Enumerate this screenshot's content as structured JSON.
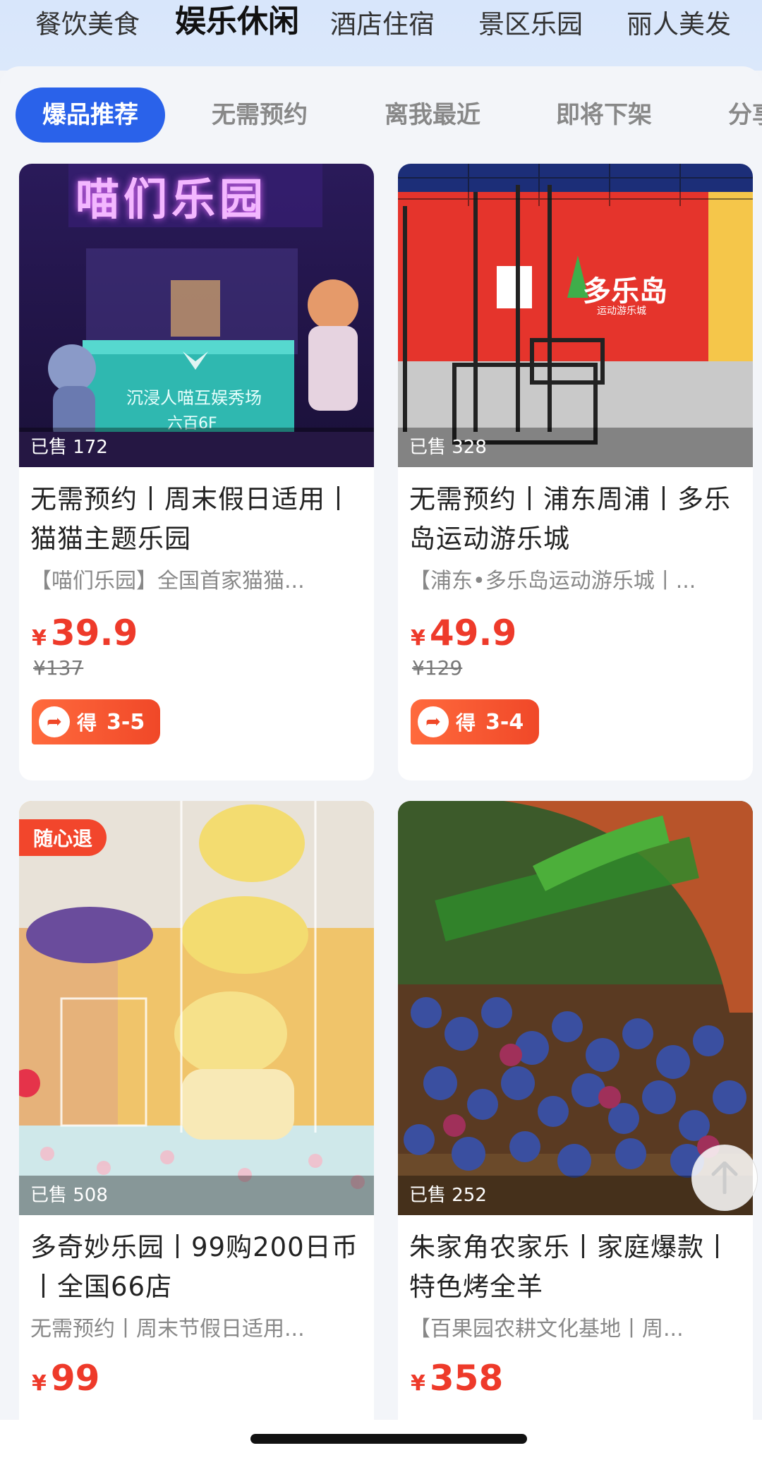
{
  "categories": [
    "餐饮美食",
    "娱乐休闲",
    "酒店住宿",
    "景区乐园",
    "丽人美发"
  ],
  "filters": [
    "爆品推荐",
    "无需预约",
    "离我最近",
    "即将下架",
    "分享"
  ],
  "items": [
    {
      "sold": "已售 172",
      "title": "无需预约丨周末假日适用丨猫猫主题乐园",
      "subtitle": "【喵们乐园】全国首家猫猫...",
      "price": "39.9",
      "orig_price": "¥137",
      "earn_label": "得",
      "earn_value": "3-5",
      "image_text_top": "喵们乐园",
      "image_text_banner": "沉浸人喵互娱秀场",
      "image_text_small": "六百6F"
    },
    {
      "sold": "已售 328",
      "title": "无需预约丨浦东周浦丨多乐岛运动游乐城",
      "subtitle": "【浦东•多乐岛运动游乐城丨...",
      "price": "49.9",
      "orig_price": "¥129",
      "earn_label": "得",
      "earn_value": "3-4",
      "image_text_sign": "多乐岛",
      "image_text_sign_sub": "运动游乐城"
    },
    {
      "sold": "已售 508",
      "tag": "随心退",
      "title": "多奇妙乐园丨99购200日币丨全国66店",
      "subtitle": "无需预约丨周末节假日适用...",
      "price": "99"
    },
    {
      "sold": "已售 252",
      "title": "朱家角农家乐丨家庭爆款丨特色烤全羊",
      "subtitle": "【百果园农耕文化基地丨周...",
      "price": "358"
    }
  ],
  "currency": "¥",
  "colors": {
    "accent": "#2a62ea",
    "price": "#ee3a2a",
    "tag": "#f2462c"
  }
}
